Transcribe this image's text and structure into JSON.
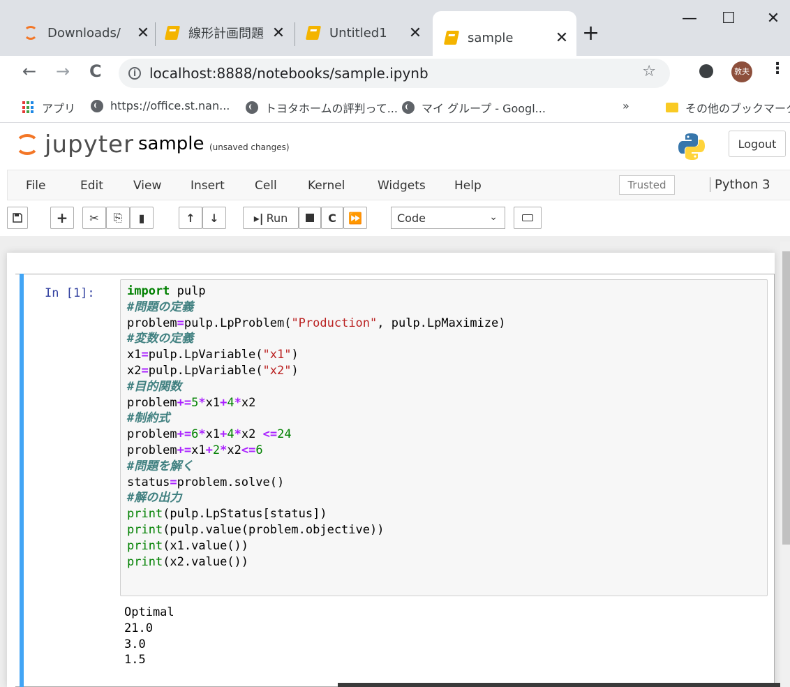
{
  "browser": {
    "tabs": [
      {
        "title": "Downloads/",
        "close": "✕"
      },
      {
        "title": "線形計画問題",
        "close": "✕"
      },
      {
        "title": "Untitled1",
        "close": "✕"
      },
      {
        "title": "sample",
        "close": "✕"
      }
    ],
    "new_tab": "+",
    "window": {
      "minimize": "—",
      "maximize": "☐",
      "close": "✕"
    },
    "nav": {
      "back": "←",
      "forward": "→",
      "reload": "C"
    },
    "url": "localhost:8888/notebooks/sample.ipynb",
    "profile": "敦夫",
    "bookmarks": [
      {
        "label": "アプリ"
      },
      {
        "label": "https://office.st.nan..."
      },
      {
        "label": "トヨタホームの評判って..."
      },
      {
        "label": "マイ グループ - Googl..."
      }
    ],
    "bookmarks_overflow": "»",
    "other_bookmarks": "その他のブックマーク"
  },
  "jupyter": {
    "logo_text": "jupyter",
    "notebook_name": "sample",
    "save_status": "(unsaved changes)",
    "logout": "Logout",
    "menus": [
      "File",
      "Edit",
      "View",
      "Insert",
      "Cell",
      "Kernel",
      "Widgets",
      "Help"
    ],
    "trusted": "Trusted",
    "kernel": "Python 3",
    "toolbar": {
      "run_label": "Run",
      "cell_type": "Code"
    }
  },
  "cell": {
    "prompt": "In [1]:",
    "code_lines": [
      "import pulp",
      "#問題の定義",
      "problem=pulp.LpProblem(\"Production\", pulp.LpMaximize)",
      "#変数の定義",
      "x1=pulp.LpVariable(\"x1\")",
      "x2=pulp.LpVariable(\"x2\")",
      "#目的関数",
      "problem+=5*x1+4*x2",
      "#制約式",
      "problem+=6*x1+4*x2 <=24",
      "problem+=x1+2*x2<=6",
      "#問題を解く",
      "status=problem.solve()",
      "#解の出力",
      "print(pulp.LpStatus[status])",
      "print(pulp.value(problem.objective))",
      "print(x1.value())",
      "print(x2.value())"
    ],
    "output_lines": [
      "Optimal",
      "21.0",
      "3.0",
      "1.5"
    ]
  }
}
